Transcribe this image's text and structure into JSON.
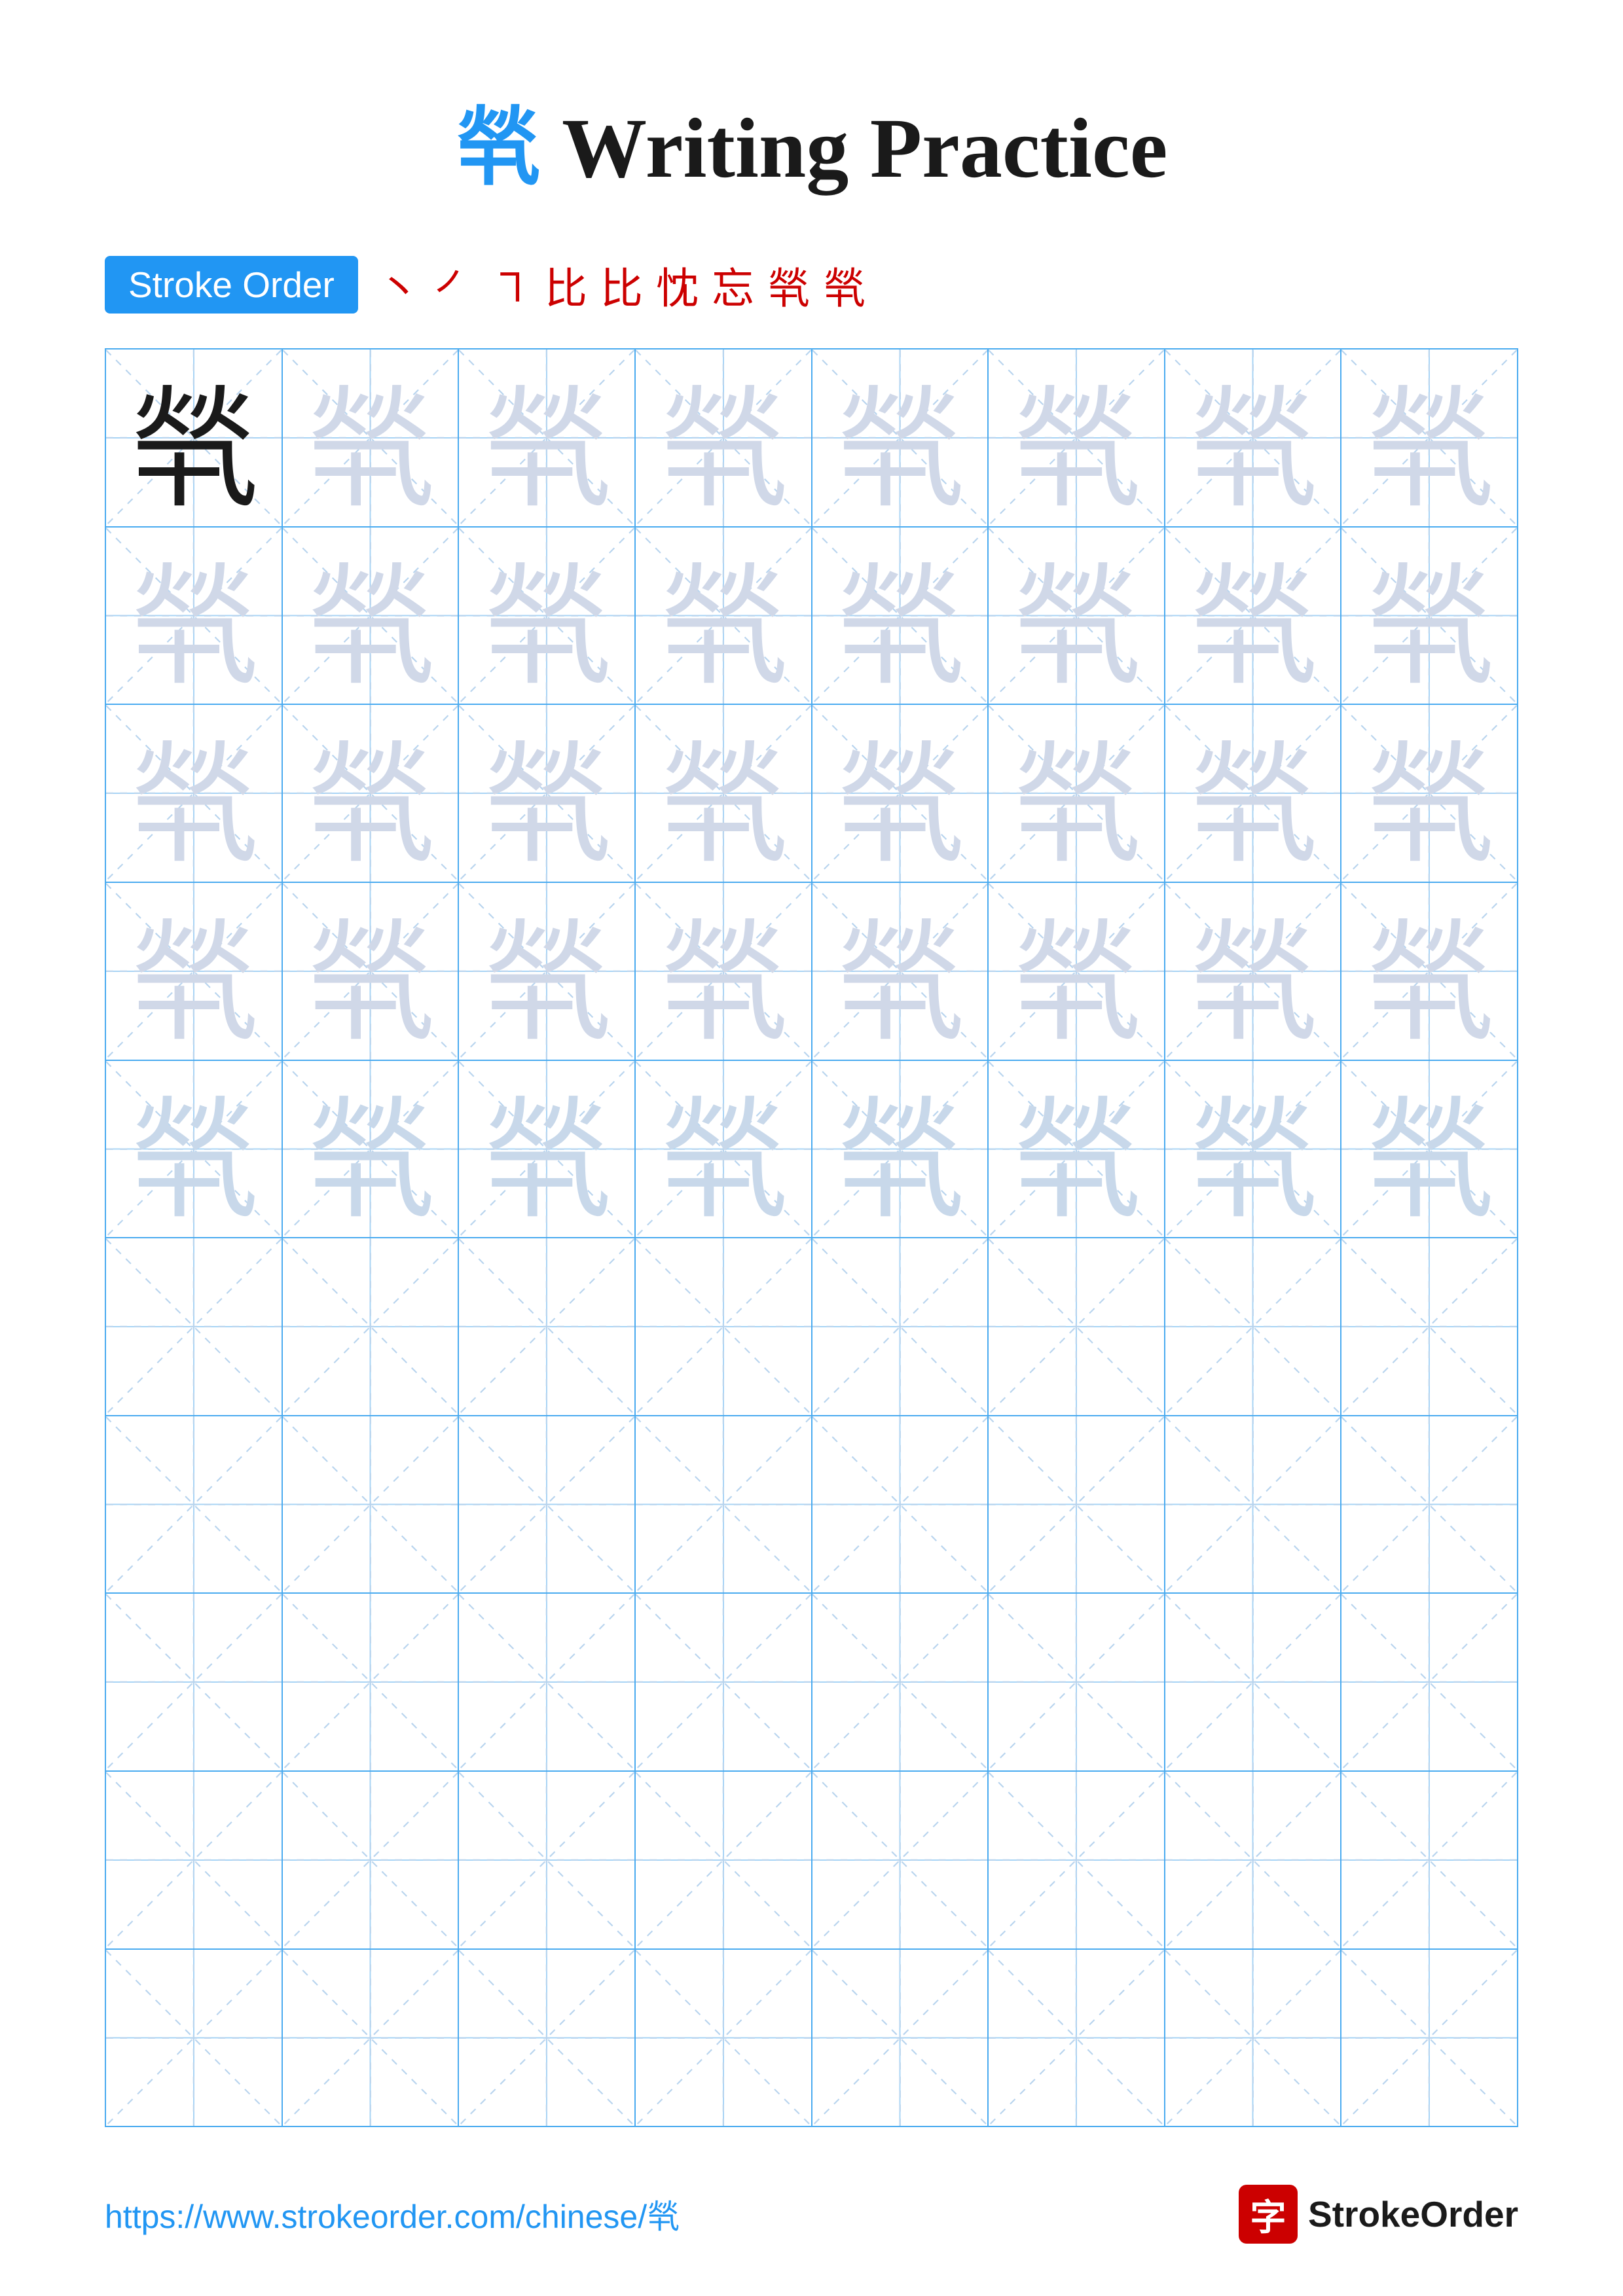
{
  "title": {
    "char": "㷀",
    "text": " Writing Practice",
    "char_display": "㷀"
  },
  "stroke_order": {
    "badge_label": "Stroke Order",
    "strokes": [
      "丶",
      "㇒",
      "㇕",
      "比",
      "比",
      "比忄",
      "忘",
      "㷀",
      "㷀"
    ]
  },
  "grid": {
    "rows": 10,
    "cols": 8,
    "filled_rows": 5,
    "char": "㷀"
  },
  "footer": {
    "url": "https://www.strokeorder.com/chinese/㷀",
    "brand": "StrokeOrder",
    "brand_char": "字"
  }
}
